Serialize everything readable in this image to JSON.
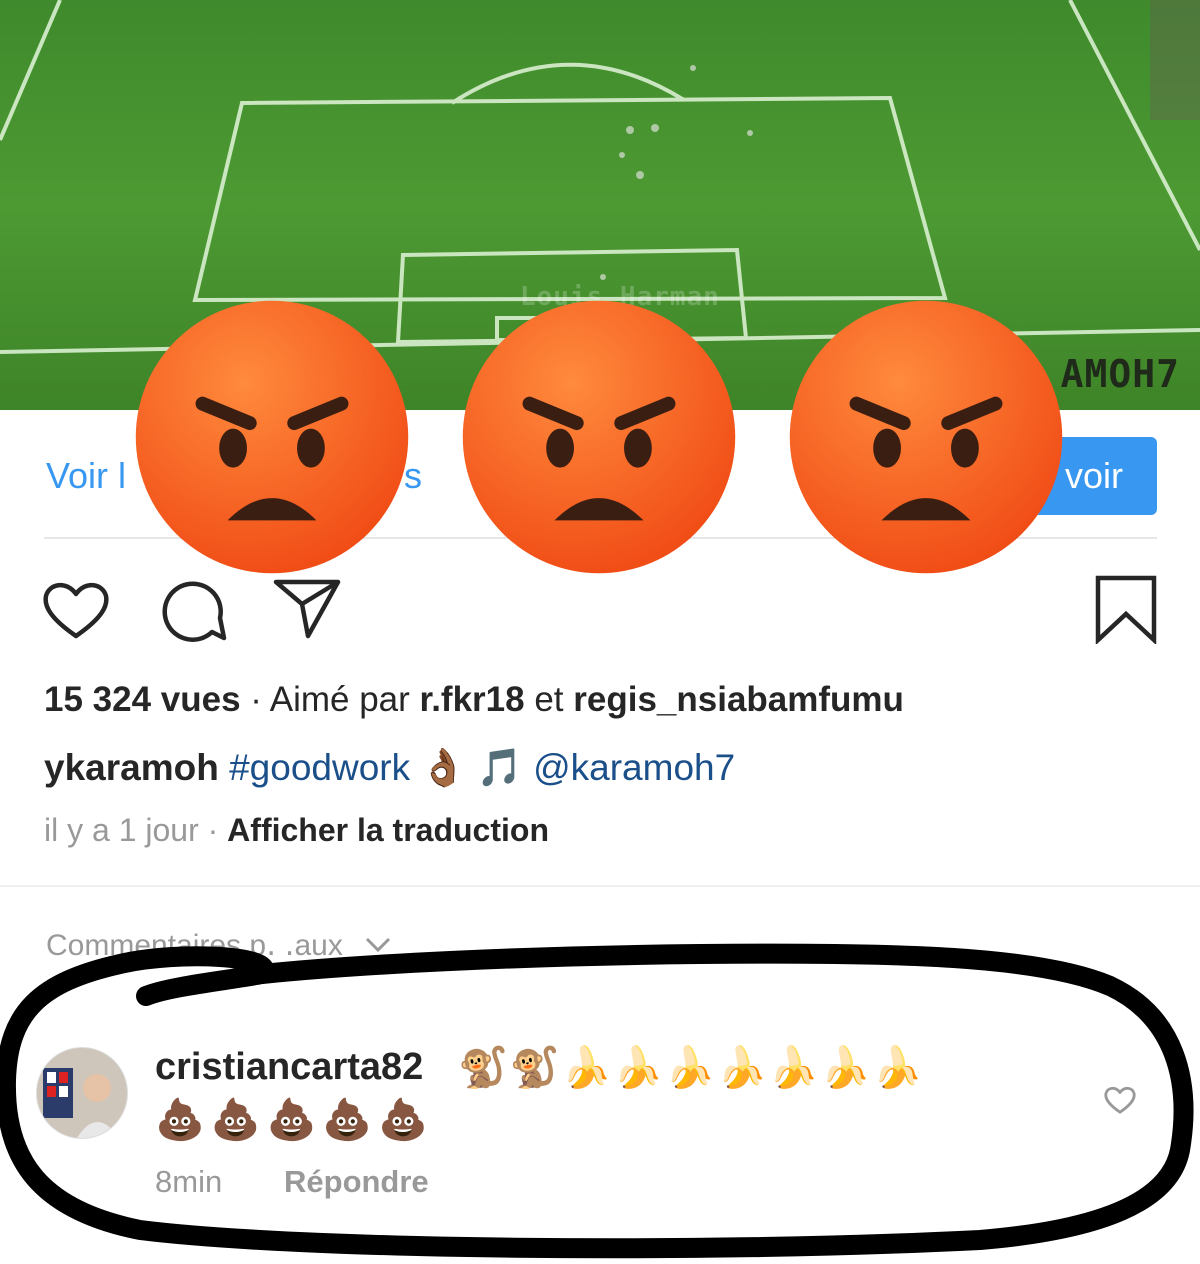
{
  "video": {
    "watermark_center": "Louis Harman",
    "watermark_right": "AMOH7"
  },
  "profile_bar": {
    "link_left": "Voir l",
    "link_mid": "s",
    "button_label": "voir"
  },
  "overlay": {
    "emoji_icons": [
      "angry-face-icon",
      "angry-face-icon",
      "angry-face-icon"
    ]
  },
  "actions": {
    "icons": [
      "heart-icon",
      "comment-icon",
      "share-icon",
      "bookmark-icon"
    ]
  },
  "post": {
    "views": "15 324 vues",
    "liked_prefix": " · Aimé par ",
    "liker1": "r.fkr18",
    "liker_sep": " et ",
    "liker2": "regis_nsiabamfumu",
    "author": "ykaramoh",
    "hashtag": "#goodwork",
    "caption_emojis": "👌🏾 🎵",
    "mention": "@karamoh7",
    "time": "il y a 1 jour",
    "meta_sep": " · ",
    "translate": "Afficher la traduction"
  },
  "comments": {
    "sort_label": "Commentaires p․  ․aux",
    "items": [
      {
        "username": "cristiancarta82",
        "text_line1": "🐒🐒🍌🍌🍌🍌🍌🍌🍌",
        "text_line2": "💩💩💩💩💩",
        "time": "8min",
        "reply": "Répondre",
        "icons": [
          "like-heart-icon"
        ]
      }
    ]
  },
  "colors": {
    "link_blue": "#3897f0",
    "mention_blue": "#1b4f8a",
    "pitch_green": "#4d9a33",
    "marker_black": "#000000",
    "emoji_orange": "#f5521e"
  }
}
